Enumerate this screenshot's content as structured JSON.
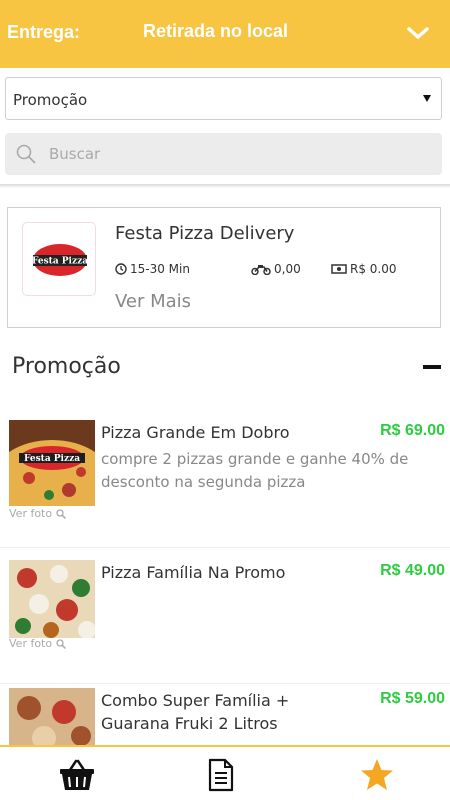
{
  "header": {
    "delivery_label": "Entrega:",
    "delivery_value": "Retirada no local"
  },
  "category_select": {
    "selected": "Promoção"
  },
  "search": {
    "placeholder": "Buscar"
  },
  "restaurant": {
    "logo_text": "Festa Pizza",
    "name": "Festa Pizza Delivery",
    "time": "15-30 Min",
    "delivery_fee": "0,00",
    "min_order": "R$ 0.00",
    "more_label": "Ver Mais"
  },
  "section": {
    "title": "Promoção"
  },
  "items": [
    {
      "title": "Pizza Grande Em Dobro",
      "price": "R$ 69.00",
      "description": "compre 2 pizzas grande e ganhe 40% de desconto na segunda pizza",
      "photo_label": "Ver foto",
      "thumb_text": "Festa Pizza"
    },
    {
      "title": "Pizza Família Na Promo",
      "price": "R$ 49.00",
      "description": "",
      "photo_label": "Ver foto"
    },
    {
      "title": "Combo Super Família + Guarana Fruki 2 Litros",
      "price": "R$ 59.00",
      "description": ""
    }
  ],
  "colors": {
    "accent": "#f8c542",
    "price": "#2ecc40"
  },
  "bottom_nav": [
    "basket-icon",
    "order-list-icon",
    "favorites-star-icon"
  ]
}
